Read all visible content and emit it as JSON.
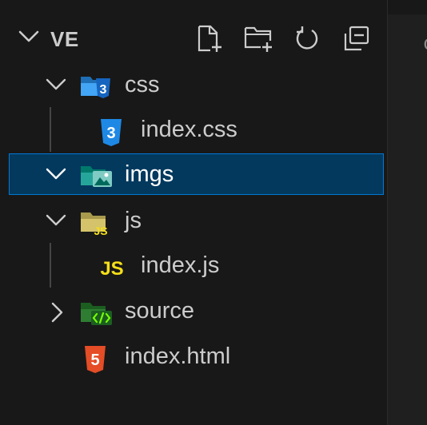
{
  "explorer": {
    "root_label": "VE",
    "actions": [
      {
        "name": "new-file-icon"
      },
      {
        "name": "new-folder-icon"
      },
      {
        "name": "refresh-icon"
      },
      {
        "name": "collapse-all-icon"
      }
    ],
    "tree": [
      {
        "label": "css",
        "type": "folder",
        "expanded": true,
        "icon": "css-folder-icon",
        "icon_color": "#42a5f5"
      },
      {
        "label": "index.css",
        "type": "file",
        "icon": "css-file-icon",
        "icon_color": "#1e88e5"
      },
      {
        "label": "imgs",
        "type": "folder",
        "expanded": true,
        "selected": true,
        "icon": "images-folder-icon",
        "icon_color": "#26a69a"
      },
      {
        "label": "js",
        "type": "folder",
        "expanded": true,
        "icon": "js-folder-icon",
        "icon_color": "#d4c36a"
      },
      {
        "label": "index.js",
        "type": "file",
        "icon": "js-file-icon",
        "icon_color": "#f5de19",
        "icon_text": "JS"
      },
      {
        "label": "source",
        "type": "folder",
        "expanded": false,
        "icon": "source-folder-icon",
        "icon_color": "#2e7d32"
      },
      {
        "label": "index.html",
        "type": "file",
        "icon": "html-file-icon",
        "icon_color": "#e44d26"
      }
    ]
  },
  "editor_peek": "c",
  "colors": {
    "background": "#181818",
    "selection": "#04395e",
    "focus_border": "#0078d4",
    "text": "#cccccc"
  }
}
